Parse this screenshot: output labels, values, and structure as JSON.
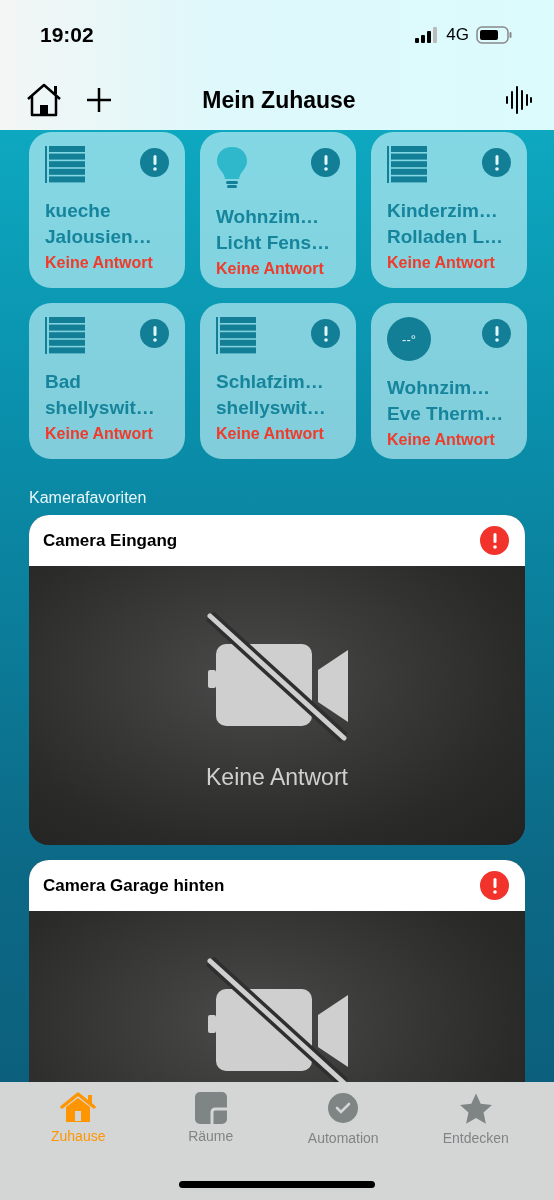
{
  "status_bar": {
    "time": "19:02",
    "network": "4G"
  },
  "nav": {
    "title": "Mein Zuhause"
  },
  "tiles": [
    {
      "kind": "blinds",
      "name": "kueche",
      "subtitle": "Jalousien…",
      "status": "Keine Antwort",
      "alert": true
    },
    {
      "kind": "bulb",
      "name": "Wohnzim…",
      "subtitle": "Licht Fens…",
      "status": "Keine Antwort",
      "alert": true
    },
    {
      "kind": "blinds",
      "name": "Kinderzim…",
      "subtitle": "Rolladen L…",
      "status": "Keine Antwort",
      "alert": true
    },
    {
      "kind": "blinds",
      "name": "Bad",
      "subtitle": "shellyswit…",
      "status": "Keine Antwort",
      "alert": true
    },
    {
      "kind": "blinds",
      "name": "Schlafzim…",
      "subtitle": "shellyswit…",
      "status": "Keine Antwort",
      "alert": true
    },
    {
      "kind": "thermostat",
      "reading": "--°",
      "name": "Wohnzim…",
      "subtitle": "Eve Therm…",
      "status": "Keine Antwort",
      "alert": true
    }
  ],
  "section_title": "Kamerafavoriten",
  "cameras": [
    {
      "title": "Camera Eingang",
      "alert": true,
      "status": "Keine Antwort"
    },
    {
      "title": "Camera Garage hinten",
      "alert": true
    }
  ],
  "tabs": [
    {
      "kind": "home",
      "label": "Zuhause",
      "selected": true
    },
    {
      "kind": "rooms",
      "label": "Räume",
      "selected": false
    },
    {
      "kind": "automation",
      "label": "Automation",
      "selected": false
    },
    {
      "kind": "discover",
      "label": "Entdecken",
      "selected": false
    }
  ]
}
